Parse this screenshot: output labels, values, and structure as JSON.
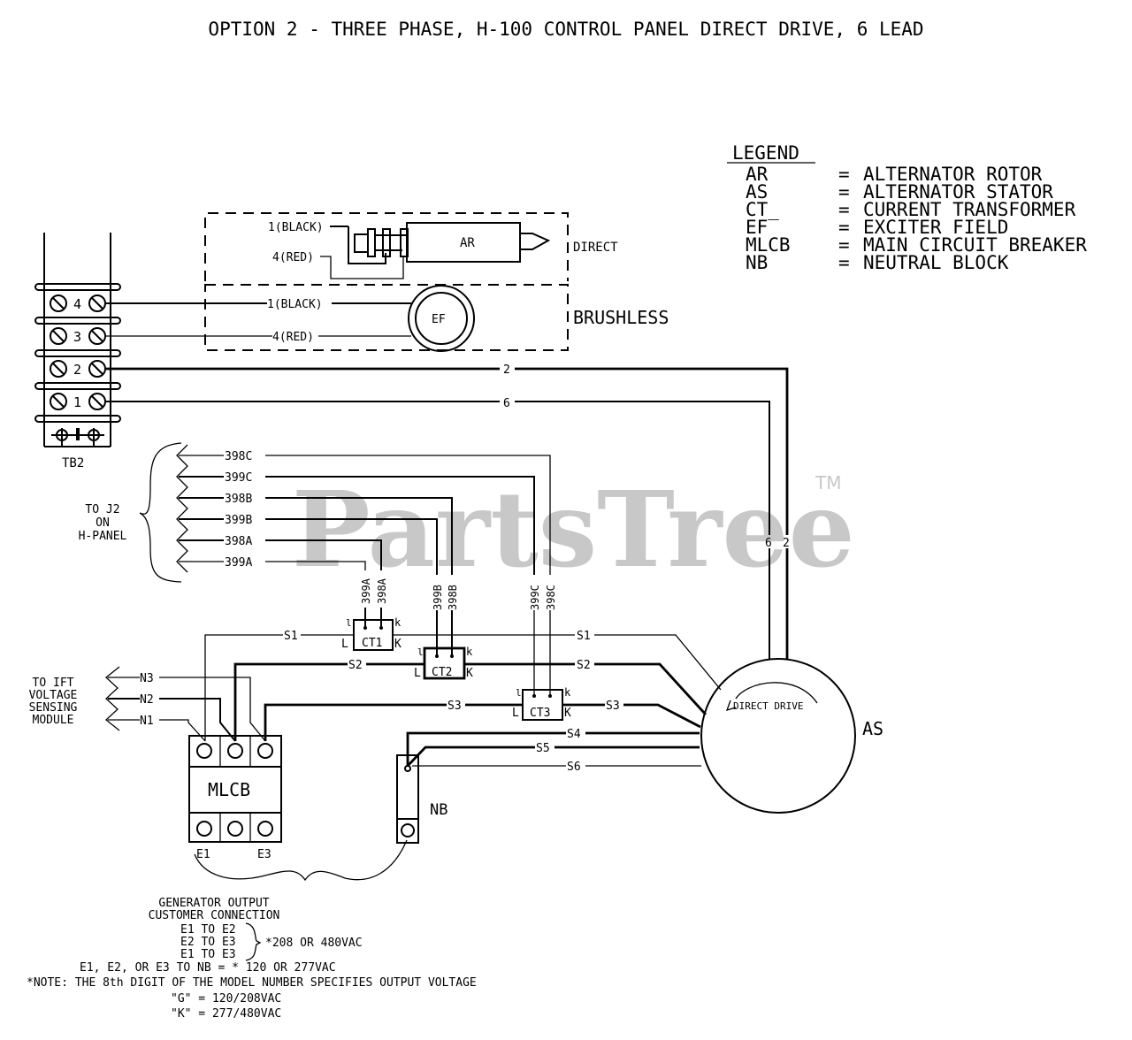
{
  "title": "OPTION 2 - THREE PHASE, H-100 CONTROL PANEL DIRECT DRIVE, 6 LEAD",
  "watermark": {
    "text": "PartsTree",
    "tm": "TM",
    "color": "#c8c8c8"
  },
  "legend": {
    "heading": "LEGEND",
    "entries": [
      {
        "abbr": "AR",
        "eq": "=",
        "desc": "ALTERNATOR ROTOR"
      },
      {
        "abbr": "AS",
        "eq": "=",
        "desc": "ALTERNATOR STATOR"
      },
      {
        "abbr": "CT_",
        "eq": "=",
        "desc": "CURRENT TRANSFORMER"
      },
      {
        "abbr": "EF",
        "eq": "=",
        "desc": "EXCITER FIELD"
      },
      {
        "abbr": "MLCB",
        "eq": "=",
        "desc": "MAIN CIRCUIT BREAKER"
      },
      {
        "abbr": "NB",
        "eq": "=",
        "desc": "NEUTRAL BLOCK"
      }
    ]
  },
  "terminal_block": {
    "label": "TB2",
    "terminals": [
      "4",
      "3",
      "2",
      "1"
    ]
  },
  "direct_box": {
    "label": "DIRECT",
    "wire1": "1(BLACK)",
    "wire4": "4(RED)",
    "rotor": "AR"
  },
  "brushless_box": {
    "label": "BRUSHLESS",
    "wire1": "1(BLACK)",
    "wire4": "4(RED)",
    "field": "EF"
  },
  "wires": {
    "w2": "2",
    "w6": "6",
    "vertical": [
      "6",
      "2"
    ]
  },
  "j2": {
    "label_lines": [
      "TO J2",
      "ON",
      "H-PANEL"
    ],
    "leads": [
      "398C",
      "399C",
      "398B",
      "399B",
      "398A",
      "399A"
    ]
  },
  "ct": [
    {
      "name": "CT1",
      "leads": [
        "399A",
        "398A"
      ],
      "small_l": "l",
      "small_k": "k",
      "big_l": "L",
      "big_k": "K"
    },
    {
      "name": "CT2",
      "leads": [
        "399B",
        "398B"
      ],
      "small_l": "l",
      "small_k": "k",
      "big_l": "L",
      "big_k": "K"
    },
    {
      "name": "CT3",
      "leads": [
        "399C",
        "398C"
      ],
      "small_l": "l",
      "small_k": "k",
      "big_l": "L",
      "big_k": "K"
    }
  ],
  "stator_leads": {
    "s1": "S1",
    "s2": "S2",
    "s3": "S3",
    "s4": "S4",
    "s5": "S5",
    "s6": "S6"
  },
  "ift": {
    "label_lines": [
      "TO IFT",
      "VOLTAGE",
      "SENSING",
      "MODULE"
    ],
    "leads": [
      "N3",
      "N2",
      "N1"
    ]
  },
  "mlcb": {
    "label": "MLCB",
    "e1": "E1",
    "e3": "E3"
  },
  "nb": {
    "label": "NB"
  },
  "stator": {
    "label": "AS",
    "rotation": "DIRECT DRIVE"
  },
  "notes": {
    "heading1": "GENERATOR OUTPUT",
    "heading2": "CUSTOMER CONNECTION",
    "pairs": [
      "E1 TO E2",
      "E2 TO E3",
      "E1 TO E3"
    ],
    "pairs_voltage": "*208 OR 480VAC",
    "neutral": "E1, E2, OR E3 TO NB = * 120 OR 277VAC",
    "note": "*NOTE: THE 8th DIGIT OF THE MODEL NUMBER SPECIFIES OUTPUT VOLTAGE",
    "g": "\"G\" = 120/208VAC",
    "k": "\"K\" = 277/480VAC"
  }
}
